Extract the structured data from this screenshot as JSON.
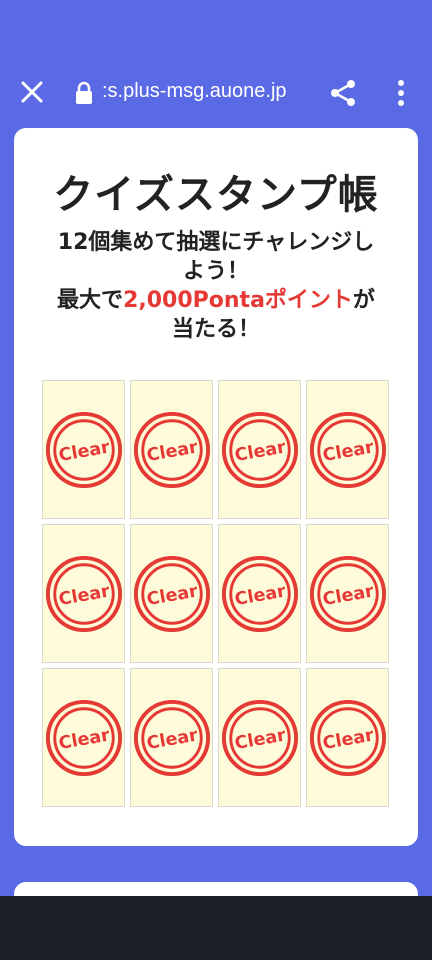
{
  "browser": {
    "url": ":s.plus-msg.auone.jp"
  },
  "card": {
    "title": "クイズスタンプ帳",
    "subtitle_line1": "12個集めて抽選にチャレンジし",
    "subtitle_line2": "よう！",
    "subtitle_line3_pre": "最大で",
    "subtitle_line3_highlight": "2,000Pontaポイント",
    "subtitle_line3_post": "が",
    "subtitle_line4": "当たる！"
  },
  "stamps": {
    "label": "Clear",
    "count": 12
  },
  "colors": {
    "header_bg": "#5a69e4",
    "stamp_red": "#e53935",
    "cell_bg": "#fdfbd9",
    "nav_bg": "#1d1f29"
  }
}
